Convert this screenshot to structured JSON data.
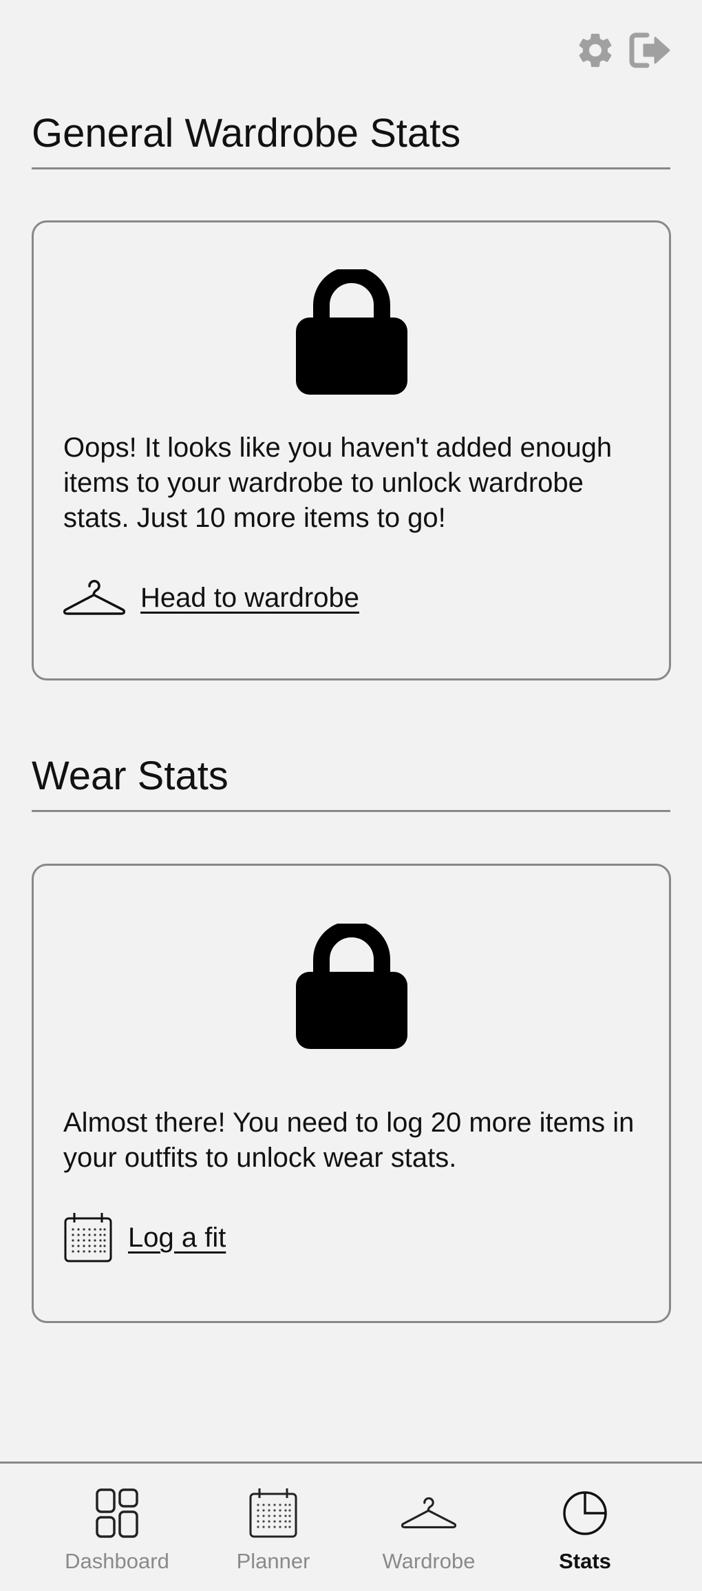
{
  "header": {
    "settings_icon": "gear-icon",
    "logout_icon": "logout-icon"
  },
  "sections": {
    "general": {
      "title": "General Wardrobe Stats",
      "message": "Oops! It looks like you haven't added enough items to your wardrobe to unlock wardrobe stats. Just 10 more items to go!",
      "link_label": "Head to wardrobe",
      "link_icon": "hanger-icon"
    },
    "wear": {
      "title": "Wear Stats",
      "message": "Almost there! You need to log 20 more items in your outfits to unlock wear stats.",
      "link_label": "Log a fit",
      "link_icon": "calendar-icon"
    }
  },
  "nav": {
    "items": [
      {
        "label": "Dashboard",
        "icon": "dashboard-icon",
        "active": false
      },
      {
        "label": "Planner",
        "icon": "calendar-icon",
        "active": false
      },
      {
        "label": "Wardrobe",
        "icon": "hanger-icon",
        "active": false
      },
      {
        "label": "Stats",
        "icon": "pie-chart-icon",
        "active": true
      }
    ]
  },
  "colors": {
    "background": "#f2f2f2",
    "border": "#888888",
    "text": "#111111",
    "muted": "#8a8a8a",
    "icon_gray": "#a0a0a0"
  }
}
